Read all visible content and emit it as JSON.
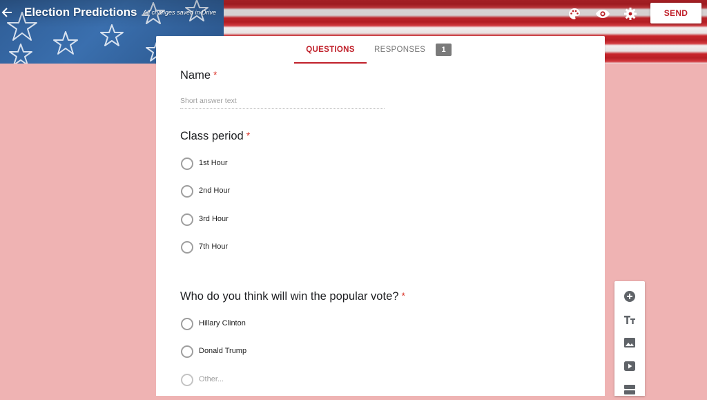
{
  "header": {
    "back_icon": "arrow-back-icon",
    "title": "Election Predictions",
    "save_status": "All changes saved in Drive",
    "icons": [
      "palette-icon",
      "eye-icon",
      "gear-icon"
    ],
    "send_label": "SEND"
  },
  "tabs": {
    "questions_label": "QUESTIONS",
    "responses_label": "RESPONSES",
    "responses_count": "1"
  },
  "questions": [
    {
      "title": "Name",
      "required": "*",
      "placeholder": "Short answer text"
    },
    {
      "title": "Class period",
      "required": "*",
      "options": [
        "1st Hour",
        "2nd Hour",
        "3rd Hour",
        "7th Hour"
      ]
    },
    {
      "title": "Who do you think will win the popular vote?",
      "required": "*",
      "options": [
        "Hillary Clinton",
        "Donald Trump",
        "Other..."
      ]
    }
  ],
  "toolbar": {
    "icons": [
      "add-question-icon",
      "add-title-icon",
      "add-image-icon",
      "add-video-icon",
      "add-section-icon"
    ]
  },
  "colors": {
    "accent": "#c0202a",
    "background": "#efb3b3",
    "required": "#d93025"
  }
}
